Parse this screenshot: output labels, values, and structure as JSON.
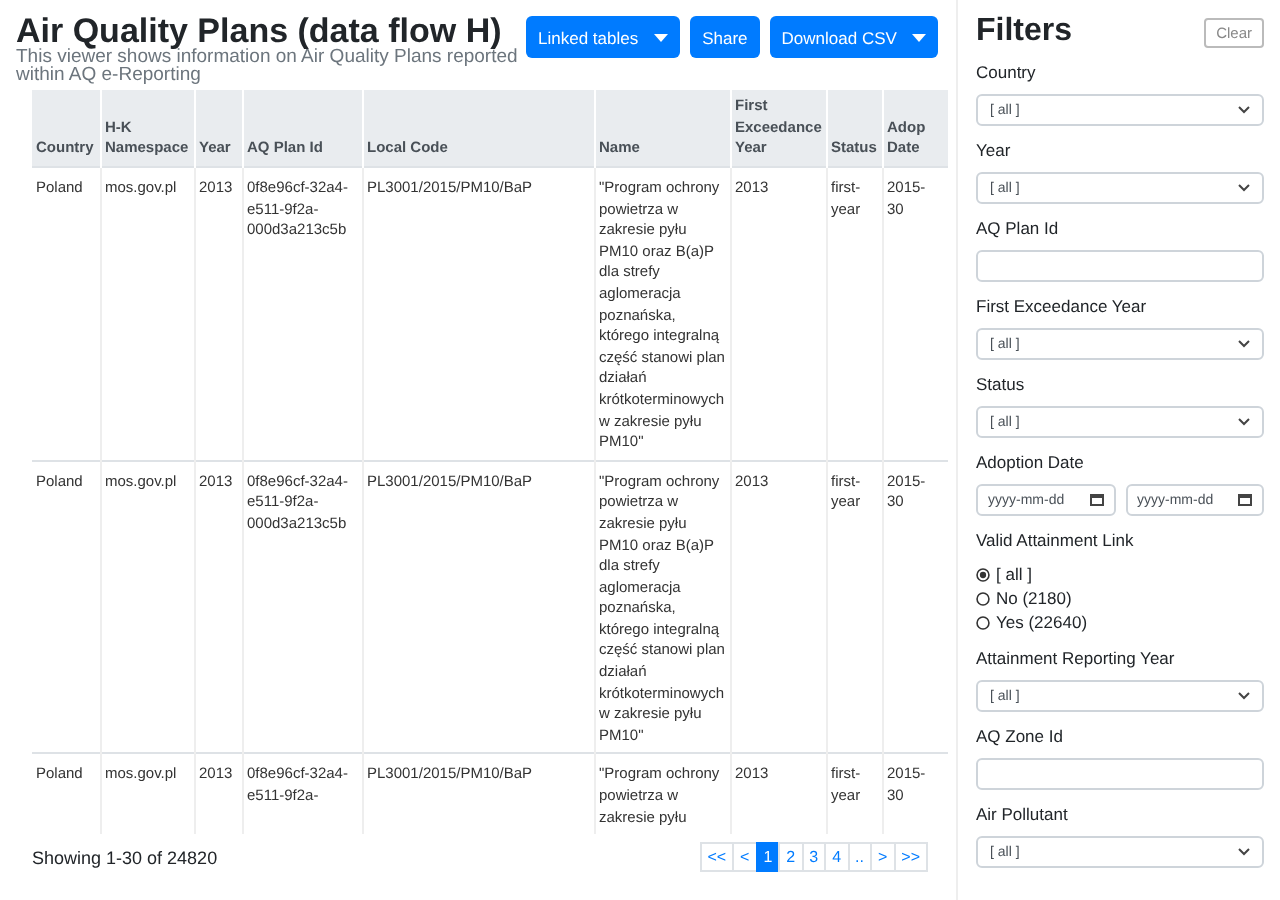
{
  "header": {
    "title": "Air Quality Plans (data flow H)",
    "subtitle": "This viewer shows information on Air Quality Plans reported within AQ e-Reporting"
  },
  "toolbar": [
    {
      "label": "Linked tables",
      "dropdown": true
    },
    {
      "label": "Share",
      "dropdown": false
    },
    {
      "label": "Download CSV",
      "dropdown": true
    }
  ],
  "table": {
    "columns": [
      "Country",
      "H-K\nNamespace",
      "Year",
      "AQ Plan Id",
      "Local Code",
      "Name",
      "First\nExceedance\nYear",
      "Status",
      "Adop\nDate"
    ],
    "rows": [
      [
        "Poland",
        "mos.gov.pl",
        "2013",
        "0f8e96cf-32a4-e511-9f2a-000d3a213c5b",
        "PL3001/2015/PM10/BaP",
        "\"Program ochrony powietrza w zakresie pyłu PM10 oraz B(a)P dla strefy aglomeracja poznańska, którego integralną część stanowi plan działań krótkoterminowych w zakresie pyłu PM10\"",
        "2013",
        "first-year",
        "2015-\n30"
      ],
      [
        "Poland",
        "mos.gov.pl",
        "2013",
        "0f8e96cf-32a4-e511-9f2a-000d3a213c5b",
        "PL3001/2015/PM10/BaP",
        "\"Program ochrony powietrza w zakresie pyłu PM10 oraz B(a)P dla strefy aglomeracja poznańska, którego integralną część stanowi plan działań krótkoterminowych w zakresie pyłu PM10\"",
        "2013",
        "first-year",
        "2015-\n30"
      ],
      [
        "Poland",
        "mos.gov.pl",
        "2013",
        "0f8e96cf-32a4-e511-9f2a-",
        "PL3001/2015/PM10/BaP",
        "\"Program ochrony powietrza w zakresie pyłu",
        "2013",
        "first-year",
        "2015-\n30"
      ]
    ]
  },
  "footer": {
    "summary": "Showing 1-30 of 24820",
    "pages": [
      {
        "label": "<<",
        "selected": false
      },
      {
        "label": "<",
        "selected": false
      },
      {
        "label": "1",
        "selected": true
      },
      {
        "label": "2",
        "selected": false
      },
      {
        "label": "3",
        "selected": false
      },
      {
        "label": "4",
        "selected": false
      },
      {
        "label": "..",
        "selected": false
      },
      {
        "label": ">",
        "selected": false
      },
      {
        "label": ">>",
        "selected": false
      }
    ]
  },
  "filters": {
    "title": "Filters",
    "clear": "Clear",
    "items": [
      {
        "kind": "select",
        "label": "Country",
        "value": "[ all ]"
      },
      {
        "kind": "select",
        "label": "Year",
        "value": "[ all ]"
      },
      {
        "kind": "text",
        "label": "AQ Plan Id"
      },
      {
        "kind": "select",
        "label": "First Exceedance Year",
        "value": "[ all ]"
      },
      {
        "kind": "select",
        "label": "Status",
        "value": "[ all ]"
      },
      {
        "kind": "dates",
        "label": "Adoption Date",
        "placeholders": [
          "yyyy-mm-dd",
          "yyyy-mm-dd"
        ]
      },
      {
        "kind": "radio",
        "label": "Valid Attainment Link",
        "options": [
          {
            "label": "[ all ]",
            "selected": true
          },
          {
            "label": "No (2180)",
            "selected": false
          },
          {
            "label": "Yes (22640)",
            "selected": false
          }
        ]
      },
      {
        "kind": "select",
        "label": "Attainment Reporting Year",
        "value": "[ all ]"
      },
      {
        "kind": "text",
        "label": "AQ Zone Id"
      },
      {
        "kind": "select",
        "label": "Air Pollutant",
        "value": "[ all ]"
      }
    ]
  }
}
